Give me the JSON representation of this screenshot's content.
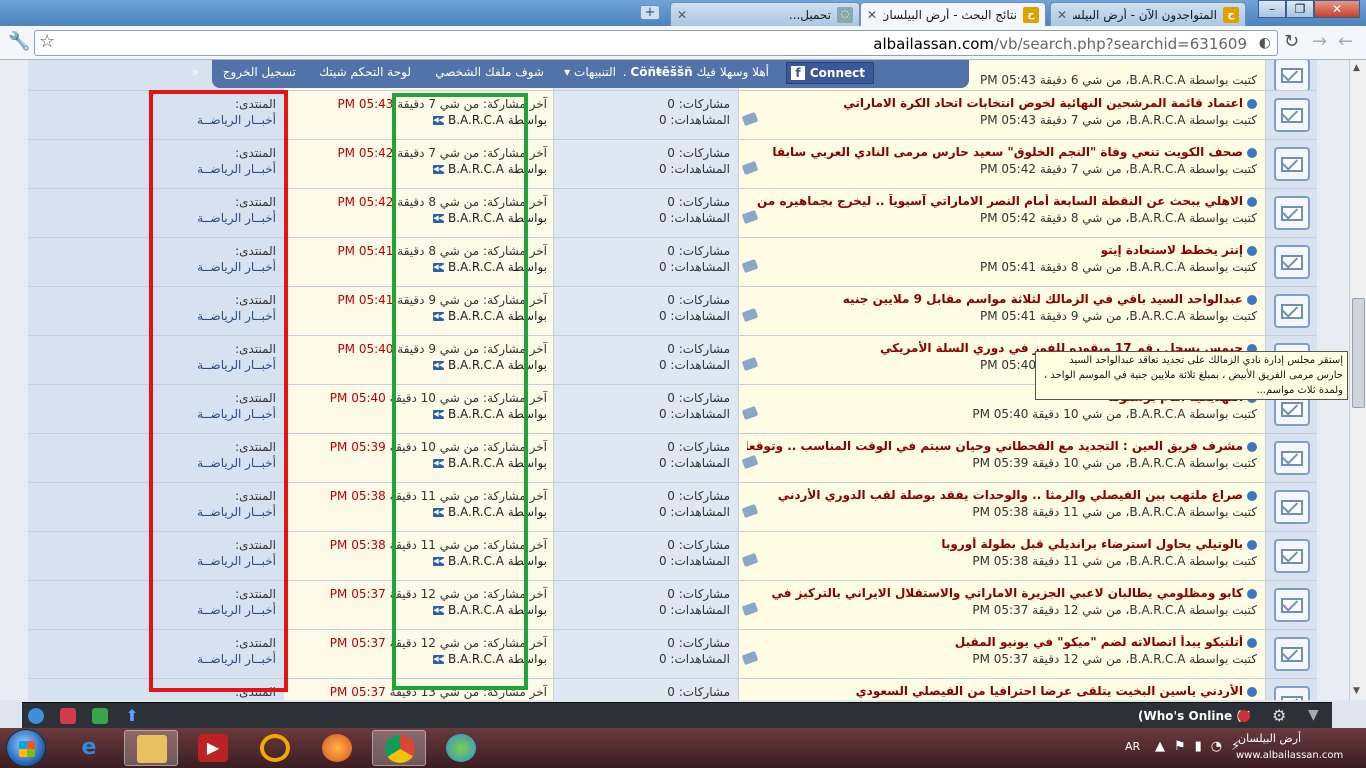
{
  "browser": {
    "tabs": [
      {
        "title": "نتائج البحث - أرض البيلسان",
        "active": true
      },
      {
        "title": "المتواجدون الآن - أرض البيلسان",
        "active": false
      },
      {
        "title": "تحميل...",
        "active": false
      }
    ],
    "url_host": "albailassan.com",
    "url_path": "/vb/search.php?searchid=631609"
  },
  "navbar": {
    "connect": "Connect",
    "greeting": "أهلا وسهلا فيك",
    "user": "Cöñŧēššñ",
    "items": [
      "التنبيهات",
      "شوف ملفك الشخصي",
      "لوحة التحكم شيتك",
      "تسجيل الخروج"
    ]
  },
  "top_partial_meta": "كتبت بواسطة B.A.R.C.A، من شي 6 دقيقة 05:43 PM",
  "labels": {
    "forum": "المنتدى:",
    "forum_name": "أخبــار الرياضــة",
    "last_post": "آخر مشاركة: من شي",
    "by": "بواسطة B.A.R.C.A",
    "replies": "مشاركات: 0",
    "views": "المشاهدات: 0"
  },
  "rows": [
    {
      "title": "اعتماد قائمة المرشحين النهائية لخوض انتخابات اتحاد الكرة الاماراتي",
      "meta": "كتبت بواسطة B.A.R.C.A، من شي 7 دقيقة 05:43 PM",
      "ago": "7 دقيقة",
      "time": "05:43 PM"
    },
    {
      "title": "صحف الكويت تنعي وفاة \"النجم الخلوق\" سعيد حارس مرمى النادي العربي سابقا",
      "meta": "كتبت بواسطة B.A.R.C.A، من شي 7 دقيقة 05:42 PM",
      "ago": "7 دقيقة",
      "time": "05:42 PM"
    },
    {
      "title": "الاهلي يبحث عن النقطة السابعة أمام النصر الاماراتي آسيوياً .. ليخرج بجماهيره من",
      "meta": "كتبت بواسطة B.A.R.C.A، من شي 8 دقيقة 05:42 PM",
      "ago": "8 دقيقة",
      "time": "05:42 PM"
    },
    {
      "title": "إنتر يخطط لاستعادة إيتو",
      "meta": "كتبت بواسطة B.A.R.C.A، من شي 8 دقيقة 05:41 PM",
      "ago": "8 دقيقة",
      "time": "05:41 PM"
    },
    {
      "title": "عبدالواحد السيد باقي في الزمالك لثلاثة مواسم مقابل 9 ملايين جنيه",
      "meta": "كتبت بواسطة B.A.R.C.A، من شي 9 دقيقة 05:41 PM",
      "ago": "9 دقيقة",
      "time": "05:41 PM"
    },
    {
      "title": "جيمس يسجل رقم 17 ويقوده للفوز في دوري السلة الأمريكي",
      "meta": "كتبت بواسطة B.A.R.C.A، من شي 9 دقيقة 05:40 PM",
      "ago": "9 دقيقة",
      "time": "05:40 PM"
    },
    {
      "title": "التهديفية امام برشلونة",
      "meta": "كتبت بواسطة B.A.R.C.A، من شي 10 دقيقة 05:40 PM",
      "ago": "10 دقيقة",
      "time": "05:40 PM"
    },
    {
      "title": "مشرف فريق العين : التجديد مع القحطاني وحيان سيتم في الوقت المناسب .. وتوقعات",
      "meta": "كتبت بواسطة B.A.R.C.A، من شي 10 دقيقة 05:39 PM",
      "ago": "10 دقيقة",
      "time": "05:39 PM"
    },
    {
      "title": "صراع ملتهب بين الفيصلي والرمثا .. والوحدات يفقد بوصلة لقب الدوري الأردني",
      "meta": "كتبت بواسطة B.A.R.C.A، من شي 11 دقيقة 05:38 PM",
      "ago": "11 دقيقة",
      "time": "05:38 PM"
    },
    {
      "title": "بالوتيلي يحاول استرضاء برانديلي قبل بطولة أوروبا",
      "meta": "كتبت بواسطة B.A.R.C.A، من شي 11 دقيقة 05:38 PM",
      "ago": "11 دقيقة",
      "time": "05:38 PM"
    },
    {
      "title": "كابو ومظلومي يطالبان لاعبي الجزيرة الاماراتي والاستقلال الايراني بالتركيز في",
      "meta": "كتبت بواسطة B.A.R.C.A، من شي 12 دقيقة 05:37 PM",
      "ago": "12 دقيقة",
      "time": "05:37 PM"
    },
    {
      "title": "أتلتيكو يبدأ اتصالاته لضم \"ميكو\" في يونيو المقبل",
      "meta": "كتبت بواسطة B.A.R.C.A، من شي 12 دقيقة 05:37 PM",
      "ago": "12 دقيقة",
      "time": "05:37 PM"
    },
    {
      "title": "الأردني ياسين البخيت يتلقى عرضا احترافيا من الفيصلي السعودي",
      "meta": "",
      "ago": "13 دقيقة",
      "time": "05:37 PM"
    }
  ],
  "tooltip": "إستقر مجلس إدارة نادي الزمالك على تجديد تعاقد عبدالواحد السيد حارس مرمى  الفريق الأبيض ، بمبلغ ثلاثة ملايين جنية في الموسم الواحد ، ولمدة ثلاث مواسم...",
  "chatbar": {
    "online": "(Who's Online (7"
  },
  "taskbar": {
    "lang": "AR"
  },
  "watermark": {
    "name": "أرض البيلسان",
    "url": "www.albailassan.com"
  },
  "colors": {
    "accent_red_box": "#e31414",
    "accent_green_box": "#1ea53a",
    "title_text": "#8b0000",
    "time_text": "#c00000"
  }
}
